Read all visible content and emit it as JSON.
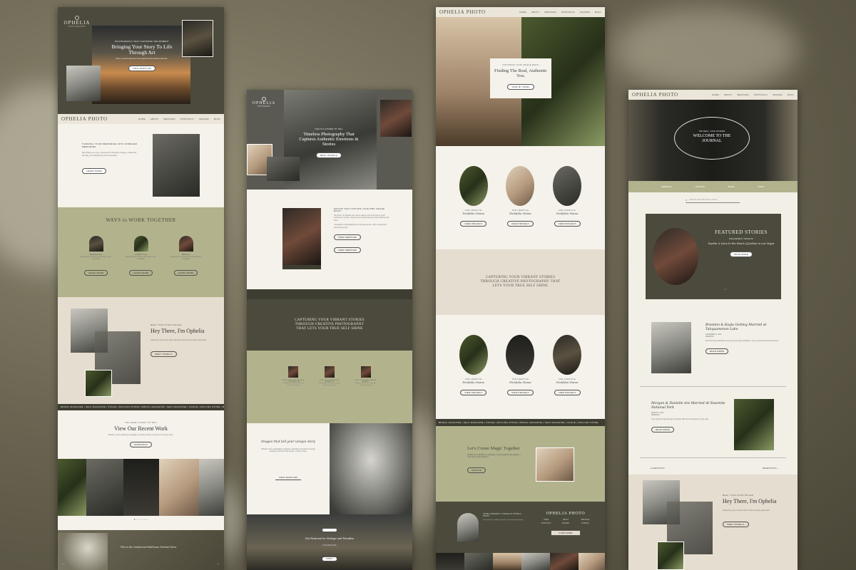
{
  "colors": {
    "olive": "#b2b28d",
    "dark": "#4b4a3c",
    "cream": "#f1efe6",
    "beige": "#e5ddcf",
    "ticker": "#3e3d31"
  },
  "p1": {
    "logo": "OPHELIA",
    "logo_sub": "PHOTOGRAPHY",
    "hero_kicker": "PHOTOGRAPHY THAT CAPTURES THE MOMENT",
    "hero_title": "Bringing Your Story To Life Through Art",
    "hero_text": "Every moment deserves to be captured with intention and care.",
    "hero_button": "VIEW SERVICES",
    "nav_brand": "OPHELIA PHOTO",
    "nav": [
      "HOME",
      "ABOUT",
      "SERVICES",
      "PORTFOLIO",
      "INQUIRE",
      "BLOG"
    ],
    "turning": "TURNING YOUR MEMORIES INTO FOREVER MEMORIES",
    "turning_text": "Everything you love, preserved in timeless imagery crafted for the way you actually live and remember.",
    "learn_more": "LEARN MORE",
    "ways_title": "WAYS to WORK TOGETHER",
    "ways_items": [
      "WEDDINGS",
      "LIFESTYLE",
      "BRAND"
    ],
    "ways_text": "Capturing the moments that matter most, beautifully.",
    "ways_button": "LEARN MORE",
    "meet_kicker": "MEET YOUR STORYTELLER",
    "meet_title": "Hey There, I'm Ophelia",
    "meet_text": "Capturing your story with a lifestyle and documentary approach.",
    "meet_button": "MEET OPHELIA",
    "ticker": "BRIDAL MAGAZINE | SELF MAGAZINE | VOGUE | ROLLING STONE | BRIDAL MAGAZINE | SELF MAGAZINE | VOGUE | ROLLING STONE | BRIDES MAGAZINE",
    "recent_kicker": "YOU HAVE A STORY TO TELL",
    "recent_title": "View Our Recent Work",
    "recent_text": "Whether you're planning a wedding or a family session, we'd love to tell your story.",
    "portfolio_button": "PORTFOLIO",
    "bottom_script": "This is the testimonial Ballroom Portrait Here"
  },
  "p2": {
    "logo": "OPHELIA",
    "logo_sub": "PHOTOGRAPHY",
    "hero_kicker": "THIS IS A KICKER TO TELL",
    "hero_title": "Timeless Photography That Captures Authentic Emotions & Stories",
    "hero_button": "MEET OPHELIA",
    "about_kicker": "PHOTOS THAT CAPTURE YOUR OWN UNIQUE MAGIC",
    "about_text": "Hey there! I'm Ophelia, and I get to capture your most honest, joyful moments for a living. I believe every couple deserves photos that feel like them.",
    "about_text2": "I specialize in photographing the real way you love, with a natural and documentary style.",
    "btn_services": "VIEW SERVICES",
    "btn_more": "VIEW SERVICES",
    "banner": "CAPTURING YOUR VIBRANT STORIES THROUGH CREATIVE PHOTOGRAPHY THAT LETS YOUR TRUE SELF SHINE",
    "services": [
      "FOR YOUR ONCE-IN-A-LIFETIME DAY",
      "FOR THE EVERYDAY MOMENTS",
      "FOR YOUR BUSINESS BRAND"
    ],
    "services_text": "Helping you tell your story with authentic imagery.",
    "script_title": "Images that tell your unique story",
    "script_text": "Whether you're celebrating a milestone, launching your brand or simply wanting to document this season, I'd love to help.",
    "script_button": "VIEW SERVICES",
    "footer_script": "Get Featured in Vintage and Paradise",
    "footer_kicker": "FOLLOW ALONG",
    "footer_button": "SUBMIT"
  },
  "p3": {
    "nav_brand": "OPHELIA PHOTO",
    "nav": [
      "HOME",
      "ABOUT",
      "SERVICES",
      "PORTFOLIO",
      "INQUIRE",
      "BLOG"
    ],
    "hero_kicker": "CAPTURING YOUR UNIQUE MAGIC",
    "hero_title": "Finding The Real, Authentic You.",
    "hero_button": "VIEW MY WORK",
    "portfolio_kicker": "FOR LIFESTYLE",
    "portfolio_kicker2": "FOR LIFESTYLE",
    "portfolio_name": "Portfolio Name",
    "portfolio_button": "VIEW PROJECT",
    "banner": "CAPTURING YOUR VIBRANT STORIES THROUGH CREATIVE PHOTOGRAPHY THAT LETS YOUR TRUE SELF SHINE",
    "ticker": "BRIDAL MAGAZINE | SELF MAGAZINE | VOGUE | ROLLING STONE | BRIDAL MAGAZINE | SELF MAGAZINE | VOGUE | ROLLING STONE",
    "magic_title": "Let's Create Magic Together",
    "magic_text": "Whether it's a wedding, a celebration, or just a beautiful day together, I can't wait to hear all about it.",
    "inquire_button": "INQUIRE",
    "footer_name": "OPHELIA BENNETT, OWNER OF OPHELIA PHOTO",
    "footer_text": "Specializing in weddings, lifestyle, and brand photography.",
    "footer_brand": "OPHELIA PHOTO",
    "footer_links": [
      "HOME",
      "ABOUT",
      "SERVICES",
      "PORTFOLIO",
      "INQUIRE",
      "JOURNAL"
    ],
    "footer_button": "SUBSCRIBE"
  },
  "p4": {
    "nav_brand": "OPHELIA PHOTO",
    "nav": [
      "HOME",
      "ABOUT",
      "SERVICES",
      "PORTFOLIO",
      "INQUIRE",
      "BLOG"
    ],
    "hero_kicker": "THE REAL, LOVE STORIES",
    "hero_title": "WELCOME TO THE JOURNAL",
    "categories": [
      "WEDDINGS",
      "LIFESTYLE",
      "BRAND",
      "FAMILY"
    ],
    "search_placeholder": "SEARCH AND FIND SMALL STORY",
    "featured_title": "FEATURED STORIES",
    "featured_kicker": "ENGAGEMENT SESSION",
    "featured_script": "Sophia & Liam In the Heart of Joshua in Las Vegas",
    "featured_button": "READ MORE",
    "post1_title": "Brandon & Kayla Getting Married at Tahquamenon Lake",
    "post1_date": "NOVEMBER 8, 2023",
    "post1_cat": "WEDDING",
    "post1_text": "From the serene lakeside ceremony to the joyful celebration, every moment felt intimate and true.",
    "post1_button": "READ MORE",
    "post2_title": "Morgan & Danielle Are Married At Yosemite National Park",
    "post2_date": "MARCH 3, 2023",
    "post2_cat": "WEDDING",
    "post2_text": "They spent the day amongst the granite cliffs and towering trees of the park.",
    "post2_button": "READ MORE",
    "older": "« OLDER POSTS",
    "newer": "NEWER POSTS »",
    "meet_kicker": "MEET YOUR STORYTELLER",
    "meet_title": "Hey There, I'm Ophelia",
    "meet_text": "Capturing your real life with a documentary approach.",
    "meet_button": "MEET OPHELIA"
  }
}
